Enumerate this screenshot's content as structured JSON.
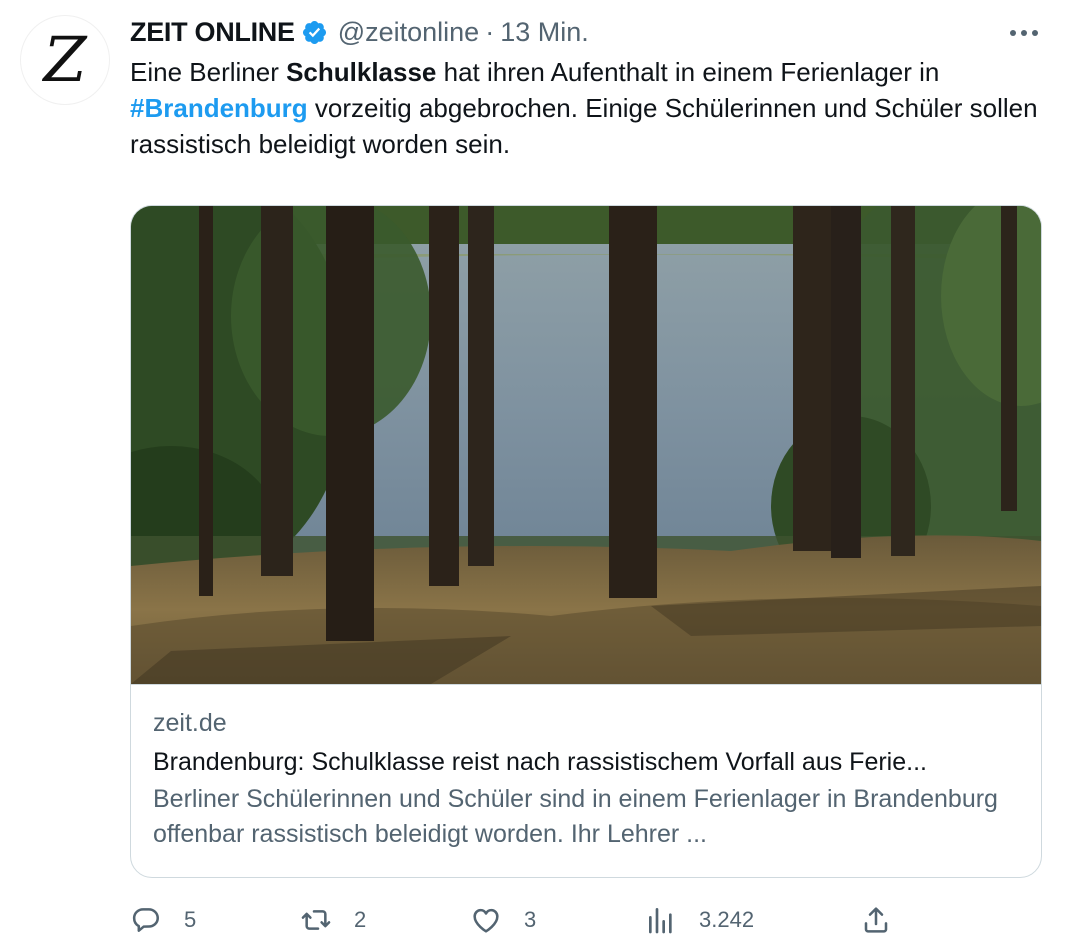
{
  "account": {
    "display_name": "ZEIT ONLINE",
    "handle": "@zeitonline",
    "separator": "·",
    "time": "13 Min.",
    "avatar_letter": "Z",
    "verified_color": "#1d9bf0"
  },
  "tweet": {
    "text_1": "Eine Berliner ",
    "text_bold": "Schulklasse",
    "text_2": " hat ihren Aufenthalt in einem Ferienlager in ",
    "hashtag": "#Brandenburg",
    "text_3": " vorzeitig abgebrochen. Einige Schülerinnen und Schüler sollen rassistisch beleidigt worden sein.",
    "hashtag_color": "#1d9bf0"
  },
  "card": {
    "domain": "zeit.de",
    "title": "Brandenburg: Schulklasse reist nach rassistischem Vorfall aus Ferie...",
    "description": "Berliner Schülerinnen und Schüler sind in einem Ferienlager in Brandenburg offenbar rassistisch beleidigt worden. Ihr Lehrer ..."
  },
  "actions": {
    "replies": "5",
    "retweets": "2",
    "likes": "3",
    "views": "3.242"
  },
  "icons": [
    "verified-badge-icon",
    "more-options-icon",
    "reply-icon",
    "retweet-icon",
    "like-icon",
    "views-icon",
    "share-icon"
  ]
}
